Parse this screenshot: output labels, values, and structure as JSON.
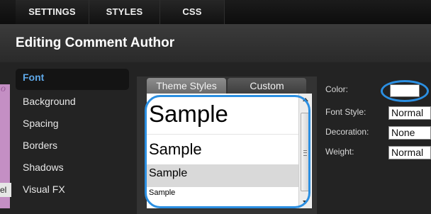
{
  "topnav": {
    "tabs": [
      "SETTINGS",
      "STYLES",
      "CSS"
    ]
  },
  "header": {
    "title": "Editing Comment Author"
  },
  "sidebar": {
    "items": [
      {
        "label": "Font",
        "active": true
      },
      {
        "label": "Background"
      },
      {
        "label": "Spacing"
      },
      {
        "label": "Borders"
      },
      {
        "label": "Shadows"
      },
      {
        "label": "Visual FX"
      }
    ]
  },
  "background_page": {
    "letter": "o",
    "label": "el"
  },
  "font_panel": {
    "tabs": [
      "Theme Styles",
      "Custom"
    ],
    "active_tab": "Theme Styles",
    "samples": [
      "Sample",
      "Sample",
      "Sample",
      "Sample"
    ],
    "selected_index": 2
  },
  "properties": {
    "color_label": "Color:",
    "color_value": "#ffffff",
    "font_style_label": "Font Style:",
    "font_style_value": "Normal",
    "decoration_label": "Decoration:",
    "decoration_value": "None",
    "weight_label": "Weight:",
    "weight_value": "Normal"
  },
  "colors": {
    "accent": "#5ea8e8",
    "highlight_outline": "#2b8fe2",
    "background_page": "#c48fc4"
  }
}
